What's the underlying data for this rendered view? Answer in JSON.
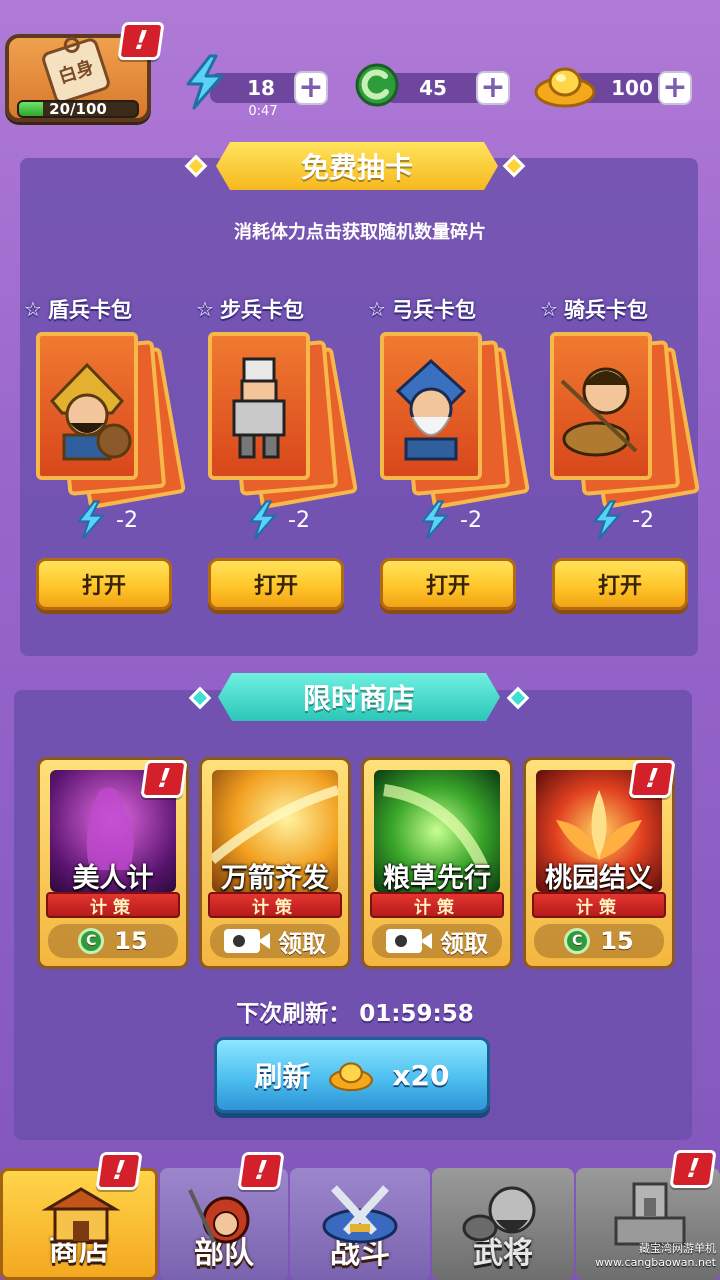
{
  "header": {
    "avatar_tag": "白身",
    "exp": {
      "current": 20,
      "max": 100,
      "text": "20/100"
    },
    "alert_mark": "!",
    "energy": {
      "value": "18",
      "timer": "0:47"
    },
    "jade": {
      "value": "45"
    },
    "gold": {
      "value": "100"
    },
    "plus": "+"
  },
  "free_draw": {
    "title": "免费抽卡",
    "subtitle": "消耗体力点击获取随机数量碎片",
    "packs": [
      {
        "name": "盾兵卡包",
        "cost": "-2",
        "button": "打开"
      },
      {
        "name": "步兵卡包",
        "cost": "-2",
        "button": "打开"
      },
      {
        "name": "弓兵卡包",
        "cost": "-2",
        "button": "打开"
      },
      {
        "name": "骑兵卡包",
        "cost": "-2",
        "button": "打开"
      }
    ]
  },
  "shop": {
    "title": "限时商店",
    "items": [
      {
        "name": "美人计",
        "tag": "计策",
        "price": "15",
        "price_type": "jade",
        "alert": "!"
      },
      {
        "name": "万箭齐发",
        "tag": "计策",
        "price": "领取",
        "price_type": "video",
        "alert": ""
      },
      {
        "name": "粮草先行",
        "tag": "计策",
        "price": "领取",
        "price_type": "video",
        "alert": ""
      },
      {
        "name": "桃园结义",
        "tag": "计策",
        "price": "15",
        "price_type": "jade",
        "alert": "!"
      }
    ],
    "refresh_label": "下次刷新：",
    "refresh_time": "01:59:58",
    "refresh_button": "刷新",
    "refresh_cost": "x20"
  },
  "nav": {
    "tabs": [
      {
        "label": "商店",
        "active": true
      },
      {
        "label": "部队",
        "active": false
      },
      {
        "label": "战斗",
        "active": false
      },
      {
        "label": "武将",
        "active": false
      },
      {
        "label": "",
        "active": false
      }
    ]
  },
  "watermark": "藏宝湾网游单机 www.cangbaowan.net",
  "colors": {
    "background": "#9a67cc",
    "panel": "#6a4eaa",
    "gold_button": "#ffc62a",
    "blue_button": "#4dbff0",
    "alert_red": "#d4202a",
    "banner_gold": "#ffd23a",
    "banner_teal": "#3fe0d0"
  }
}
